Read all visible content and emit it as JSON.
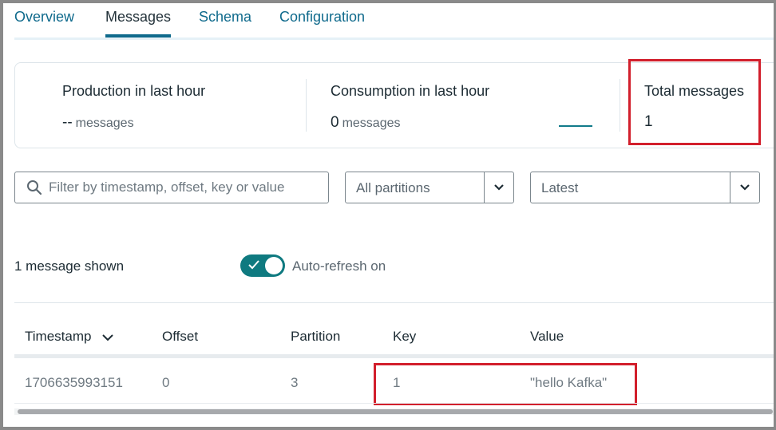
{
  "tabs": [
    {
      "label": "Overview",
      "active": false
    },
    {
      "label": "Messages",
      "active": true
    },
    {
      "label": "Schema",
      "active": false
    },
    {
      "label": "Configuration",
      "active": false
    }
  ],
  "stats": {
    "production": {
      "title": "Production in last hour",
      "value": "--",
      "unit": "messages"
    },
    "consumption": {
      "title": "Consumption in last hour",
      "value": "0",
      "unit": "messages"
    },
    "total": {
      "title": "Total messages",
      "value": "1"
    }
  },
  "filters": {
    "search_placeholder": "Filter by timestamp, offset, key or value",
    "search_icon": "search-icon",
    "partition_value": "All partitions",
    "offset_value": "Latest"
  },
  "status": {
    "shown_text": "1 message shown",
    "auto_refresh_label": "Auto-refresh on",
    "auto_refresh_on": true
  },
  "table": {
    "columns": [
      "Timestamp",
      "Offset",
      "Partition",
      "Key",
      "Value"
    ],
    "rows": [
      {
        "timestamp": "1706635993151",
        "offset": "0",
        "partition": "3",
        "key": "1",
        "value": "\"hello Kafka\""
      }
    ]
  },
  "colors": {
    "accent": "#0f7a80",
    "tab_link": "#0f6a8c",
    "highlight": "#d21f2c"
  }
}
